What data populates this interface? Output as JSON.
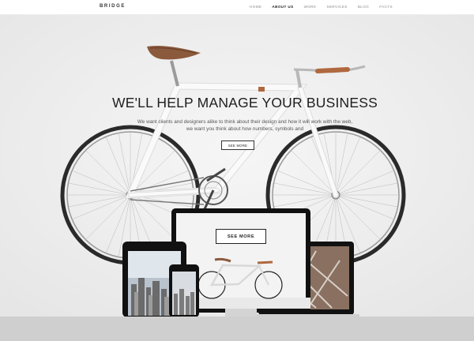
{
  "header": {
    "logo": "BRIDGE",
    "nav": [
      "HOME",
      "ABOUT US",
      "WORK",
      "SERVICES",
      "BLOG",
      "FACTS"
    ],
    "active_index": 1
  },
  "hero": {
    "title": "WE'LL HELP MANAGE YOUR BUSINESS",
    "subtitle_line1": "We want clients and designers alike to think about their design and how it will work with the web,",
    "subtitle_line2": "we want you think about how numbers, symbols and",
    "button_label": "SEE MORE"
  },
  "devices": {
    "monitor_button_label": "SEE MORE"
  }
}
